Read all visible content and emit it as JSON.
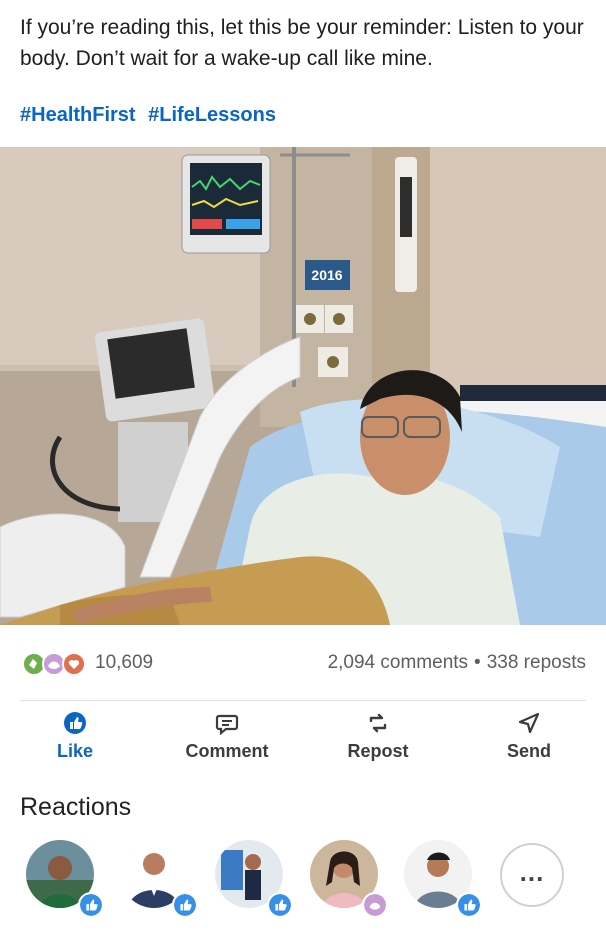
{
  "post": {
    "body": "If you’re reading this, let this be your reminder: Listen to your body. Don’t wait for a wake-up call like mine.",
    "hashtags": [
      "#HealthFirst",
      "#LifeLessons"
    ]
  },
  "photo": {
    "wall_tag": "2016"
  },
  "social": {
    "reaction_count": "10,609",
    "comments": "2,094 comments",
    "separator": "•",
    "reposts": "338 reposts",
    "reaction_icons": [
      "clap-icon",
      "support-icon",
      "love-icon"
    ]
  },
  "actions": [
    {
      "label": "Like",
      "icon": "thumbs-up-icon"
    },
    {
      "label": "Comment",
      "icon": "comment-icon"
    },
    {
      "label": "Repost",
      "icon": "repost-icon"
    },
    {
      "label": "Send",
      "icon": "send-icon"
    }
  ],
  "reactions": {
    "title": "Reactions",
    "people": [
      {
        "badge": "like"
      },
      {
        "badge": "like"
      },
      {
        "badge": "like"
      },
      {
        "badge": "support"
      },
      {
        "badge": "like"
      }
    ],
    "more_label": "..."
  },
  "colors": {
    "link": "#0a66c2",
    "like_badge": "#378fe9",
    "support_badge": "#c79bd3",
    "love_badge": "#df704d"
  }
}
